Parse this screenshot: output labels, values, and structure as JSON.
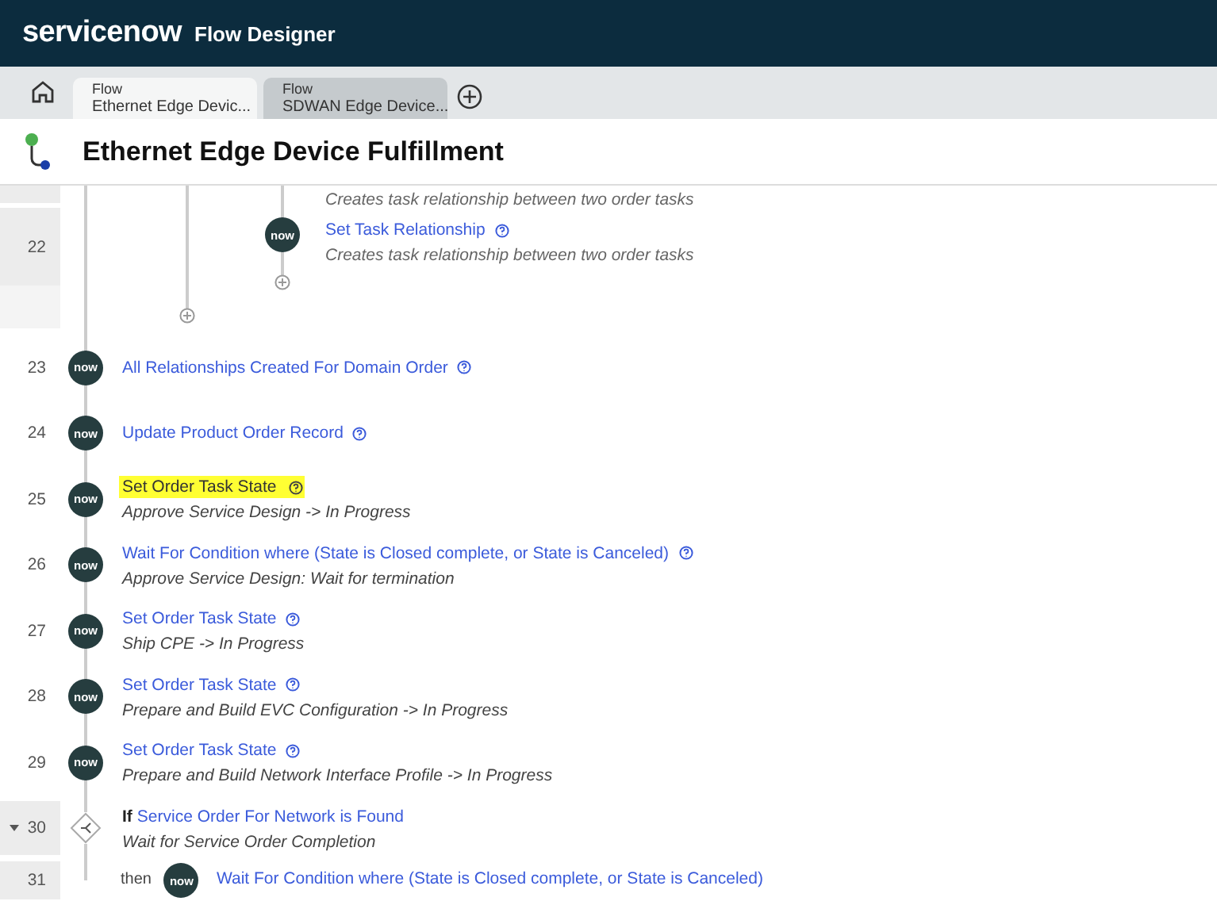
{
  "header": {
    "logo": "servicenow",
    "app": "Flow Designer"
  },
  "tabs": [
    {
      "type": "Flow",
      "title": "Ethernet Edge Devic...",
      "selected": true
    },
    {
      "type": "Flow",
      "title": "SDWAN Edge Device...",
      "selected": false
    }
  ],
  "flow_title": "Ethernet Edge Device Fulfillment",
  "nested": {
    "previous_description": "Creates task relationship between two order tasks",
    "step": {
      "number": "22",
      "badge": "now",
      "label": "Set Task Relationship",
      "description": "Creates task relationship between two order tasks"
    }
  },
  "steps": [
    {
      "kind": "action",
      "number": "23",
      "badge": "now",
      "label": "All Relationships Created For Domain Order",
      "highlighted": false
    },
    {
      "kind": "action",
      "number": "24",
      "badge": "now",
      "label": "Update Product Order Record",
      "highlighted": false
    },
    {
      "kind": "action",
      "number": "25",
      "badge": "now",
      "label": "Set Order Task State",
      "description": "Approve Service Design -> In Progress",
      "highlighted": true
    },
    {
      "kind": "action",
      "number": "26",
      "badge": "now",
      "label": "Wait For Condition where (State is Closed complete, or State is Canceled)",
      "description": "Approve Service Design: Wait for termination",
      "highlighted": false
    },
    {
      "kind": "action",
      "number": "27",
      "badge": "now",
      "label": "Set Order Task State",
      "description": "Ship CPE -> In Progress",
      "highlighted": false
    },
    {
      "kind": "action",
      "number": "28",
      "badge": "now",
      "label": "Set Order Task State",
      "description": "Prepare and Build EVC Configuration -> In Progress",
      "highlighted": false
    },
    {
      "kind": "action",
      "number": "29",
      "badge": "now",
      "label": "Set Order Task State",
      "description": "Prepare and Build Network Interface Profile -> In Progress",
      "highlighted": false
    },
    {
      "kind": "if",
      "number": "30",
      "keyword": "If",
      "label": "Service Order For Network is Found",
      "description": "Wait for Service Order Completion",
      "expanded": true
    },
    {
      "kind": "then",
      "number": "31",
      "keyword": "then",
      "badge": "now",
      "label": "Wait For Condition where (State is Closed complete, or State is Canceled)"
    }
  ]
}
